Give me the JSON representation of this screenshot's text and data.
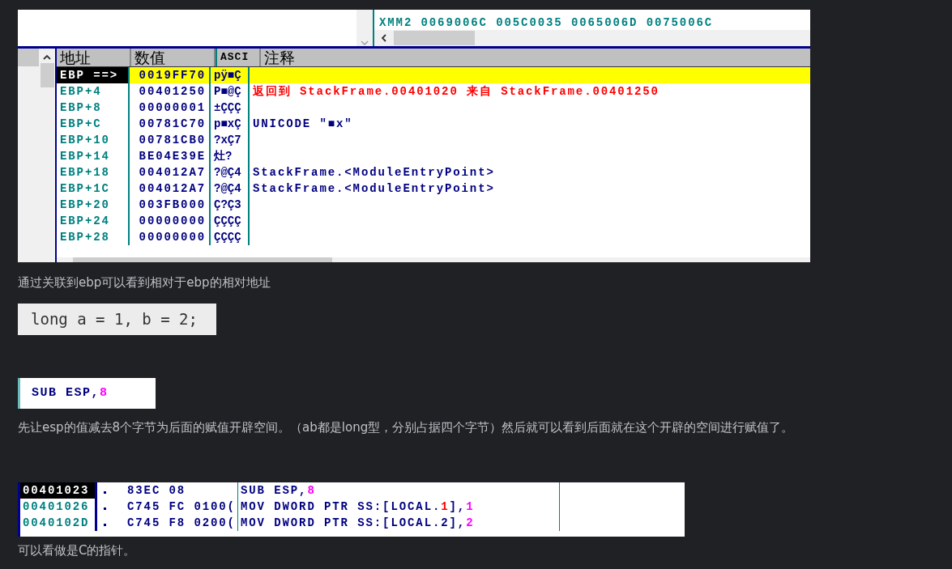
{
  "stack_view": {
    "register_line": "XMM2 0069006C 005C0035 0065006D 0075006C",
    "columns": [
      "地址",
      "数值",
      "ASCI",
      "注释"
    ],
    "rows": [
      {
        "address": "EBP ==>",
        "value": "0019FF70",
        "ascii": "pÿ■Ç",
        "comment": "",
        "selected": true,
        "kind": "plain"
      },
      {
        "address": "EBP+4",
        "value": "00401250",
        "ascii": "P■@Ç",
        "comment": "返回到 StackFrame.00401020 来自 StackFrame.00401250",
        "selected": false,
        "kind": "return"
      },
      {
        "address": "EBP+8",
        "value": "00000001",
        "ascii": "±ÇÇÇ",
        "comment": "",
        "selected": false,
        "kind": "plain"
      },
      {
        "address": "EBP+C",
        "value": "00781C70",
        "ascii": "p■xÇ",
        "comment": "UNICODE \"■x\"",
        "selected": false,
        "kind": "plain"
      },
      {
        "address": "EBP+10",
        "value": "00781CB0",
        "ascii": "?xÇ7",
        "comment": "",
        "selected": false,
        "kind": "plain"
      },
      {
        "address": "EBP+14",
        "value": "BE04E39E",
        "ascii": "灶?",
        "comment": "",
        "selected": false,
        "kind": "plain"
      },
      {
        "address": "EBP+18",
        "value": "004012A7",
        "ascii": "?@Ç4",
        "comment": "StackFrame.<ModuleEntryPoint>",
        "selected": false,
        "kind": "plain"
      },
      {
        "address": "EBP+1C",
        "value": "004012A7",
        "ascii": "?@Ç4",
        "comment": "StackFrame.<ModuleEntryPoint>",
        "selected": false,
        "kind": "plain"
      },
      {
        "address": "EBP+20",
        "value": "003FB000",
        "ascii": "Ç?Ç3",
        "comment": "",
        "selected": false,
        "kind": "plain"
      },
      {
        "address": "EBP+24",
        "value": "00000000",
        "ascii": "ÇÇÇÇ",
        "comment": "",
        "selected": false,
        "kind": "plain"
      },
      {
        "address": "EBP+28",
        "value": "00000000",
        "ascii": "ÇÇÇÇ",
        "comment": "",
        "selected": false,
        "kind": "plain"
      }
    ]
  },
  "caption_1": "通过关联到ebp可以看到相对于ebp的相对地址",
  "code_snippet": "long a = 1, b = 2;",
  "sub_snippet": [
    {
      "text": "SUB ESP,",
      "kind": "plain"
    },
    {
      "text": "8",
      "kind": "num"
    }
  ],
  "caption_2": "先让esp的值减去8个字节为后面的赋值开辟空间。（ab都是long型，分别占据四个字节）然后就可以看到后面就在这个开辟的空间进行赋值了。",
  "disassembly": [
    {
      "address": "00401023",
      "selected": true,
      "hex": "83EC 08",
      "instruction": [
        {
          "text": "SUB ESP,",
          "kind": "plain"
        },
        {
          "text": "8",
          "kind": "num"
        }
      ]
    },
    {
      "address": "00401026",
      "selected": false,
      "hex": "C745 FC 0100(",
      "instruction": [
        {
          "text": "MOV DWORD PTR SS:[LOCAL.",
          "kind": "plain"
        },
        {
          "text": "1",
          "kind": "local"
        },
        {
          "text": "],",
          "kind": "plain"
        },
        {
          "text": "1",
          "kind": "num"
        }
      ]
    },
    {
      "address": "0040102D",
      "selected": false,
      "hex": "C745 F8 0200(",
      "instruction": [
        {
          "text": "MOV DWORD PTR SS:[LOCAL.2],",
          "kind": "plain"
        },
        {
          "text": "2",
          "kind": "num"
        }
      ]
    }
  ],
  "caption_3": "可以看做是C的指针。"
}
